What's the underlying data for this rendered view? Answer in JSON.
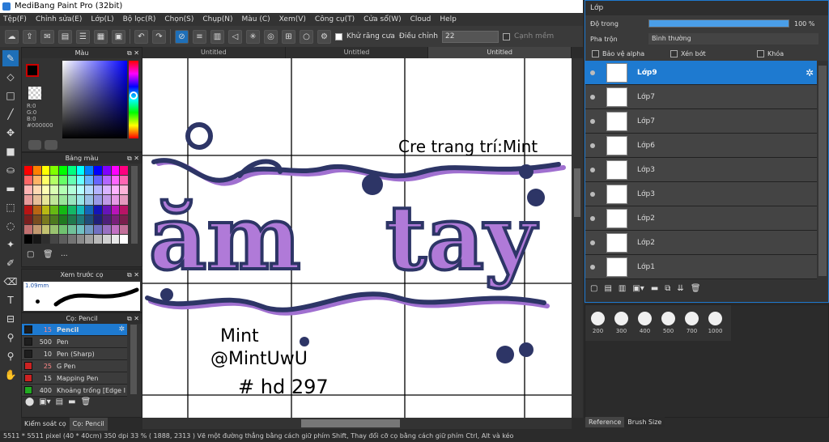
{
  "window": {
    "title": "MediBang Paint Pro (32bit)"
  },
  "menu": [
    "Tệp(F)",
    "Chỉnh sửa(E)",
    "Lớp(L)",
    "Bộ lọc(R)",
    "Chọn(S)",
    "Chụp(N)",
    "Màu (C)",
    "Xem(V)",
    "Công cụ(T)",
    "Cửa sổ(W)",
    "Cloud",
    "Help"
  ],
  "toolbar": {
    "antialias_label": "Khử răng cưa",
    "adjust_label": "Điều chỉnh",
    "adjust_value": "22",
    "sharp_label": "Cạnh mềm"
  },
  "tabs": [
    "Untitled",
    "Untitled",
    "Untitled"
  ],
  "color_panel": {
    "title": "Màu",
    "r": "R:0",
    "g": "G:0",
    "b": "B:0",
    "hex": "#000000"
  },
  "palette_panel": {
    "title": "Bảng màu",
    "more": "..."
  },
  "preview_panel": {
    "title": "Xem trước cọ",
    "size": "1.09mm"
  },
  "brush_panel": {
    "title": "Cọ: Pencil",
    "items": [
      {
        "size": "15",
        "name": "Pencil",
        "color": "#1e1e1e"
      },
      {
        "size": "500",
        "name": "Pen",
        "color": "#1e1e1e"
      },
      {
        "size": "10",
        "name": "Pen (Sharp)",
        "color": "#1e1e1e"
      },
      {
        "size": "25",
        "name": "G Pen",
        "color": "#cc2222"
      },
      {
        "size": "15",
        "name": "Mapping Pen",
        "color": "#cc2222"
      },
      {
        "size": "400",
        "name": "Khoảng trống [Edge I",
        "color": "#22aa22"
      }
    ]
  },
  "bottom_tabs": [
    "Kiểm soát cọ",
    "Cọ: Pencil"
  ],
  "layer_panel": {
    "title": "Lớp",
    "opacity_label": "Độ trong",
    "opacity_value": "100 %",
    "blend_label": "Pha trộn",
    "blend_value": "Bình thường",
    "protect_alpha": "Bảo vệ alpha",
    "clipping": "Xén bớt",
    "lock": "Khóa",
    "layers": [
      "Lớp9",
      "Lớp7",
      "Lớp7",
      "Lớp6",
      "Lớp3",
      "Lớp3",
      "Lớp2",
      "Lớp2",
      "Lớp1"
    ]
  },
  "brush_sizes": [
    "200",
    "300",
    "400",
    "500",
    "700",
    "1000"
  ],
  "right_tabs": [
    "Reference",
    "Brush Size"
  ],
  "status": "5511 * 5511 pixel   (40 * 40cm)   350 dpi   33 %   ( 1888, 2313 )   Vẽ một đường thẳng bằng cách giữ phím Shift, Thay đổi cỡ cọ bằng cách giữ phím Ctrl, Alt và kéo",
  "canvas_text": {
    "credit": "Cre trang trí:Mint",
    "sig1": "Mint",
    "sig2": "@MintUwU",
    "sig3": "# hd 297"
  },
  "colors": {
    "accent": "#1e7ad0",
    "navy": "#2d3566",
    "purple": "#a070d0"
  }
}
